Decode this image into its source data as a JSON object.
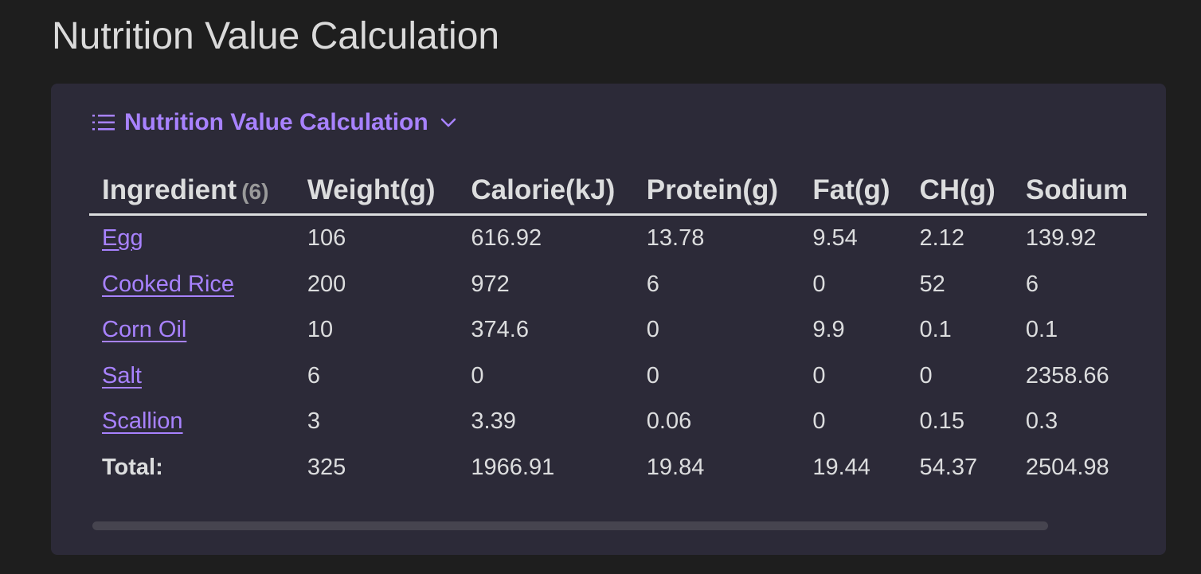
{
  "page": {
    "title": "Nutrition Value Calculation"
  },
  "view": {
    "header_label": "Nutrition Value Calculation",
    "icon": "list-icon",
    "toggle_icon": "chevron-down-icon",
    "accent_color": "#a882ff"
  },
  "table": {
    "ingredient_header": "Ingredient",
    "ingredient_count": "(6)",
    "columns": [
      "Weight(g)",
      "Calorie(kJ)",
      "Protein(g)",
      "Fat(g)",
      "CH(g)",
      "Sodium"
    ],
    "rows": [
      {
        "name": "Egg",
        "values": [
          "106",
          "616.92",
          "13.78",
          "9.54",
          "2.12",
          "139.92"
        ]
      },
      {
        "name": "Cooked Rice",
        "values": [
          "200",
          "972",
          "6",
          "0",
          "52",
          "6"
        ]
      },
      {
        "name": "Corn Oil",
        "values": [
          "10",
          "374.6",
          "0",
          "9.9",
          "0.1",
          "0.1"
        ]
      },
      {
        "name": "Salt",
        "values": [
          "6",
          "0",
          "0",
          "0",
          "0",
          "2358.66"
        ]
      },
      {
        "name": "Scallion",
        "values": [
          "3",
          "3.39",
          "0.06",
          "0",
          "0.15",
          "0.3"
        ]
      }
    ],
    "total": {
      "label": "Total:",
      "values": [
        "325",
        "1966.91",
        "19.84",
        "19.44",
        "54.37",
        "2504.98"
      ]
    }
  }
}
